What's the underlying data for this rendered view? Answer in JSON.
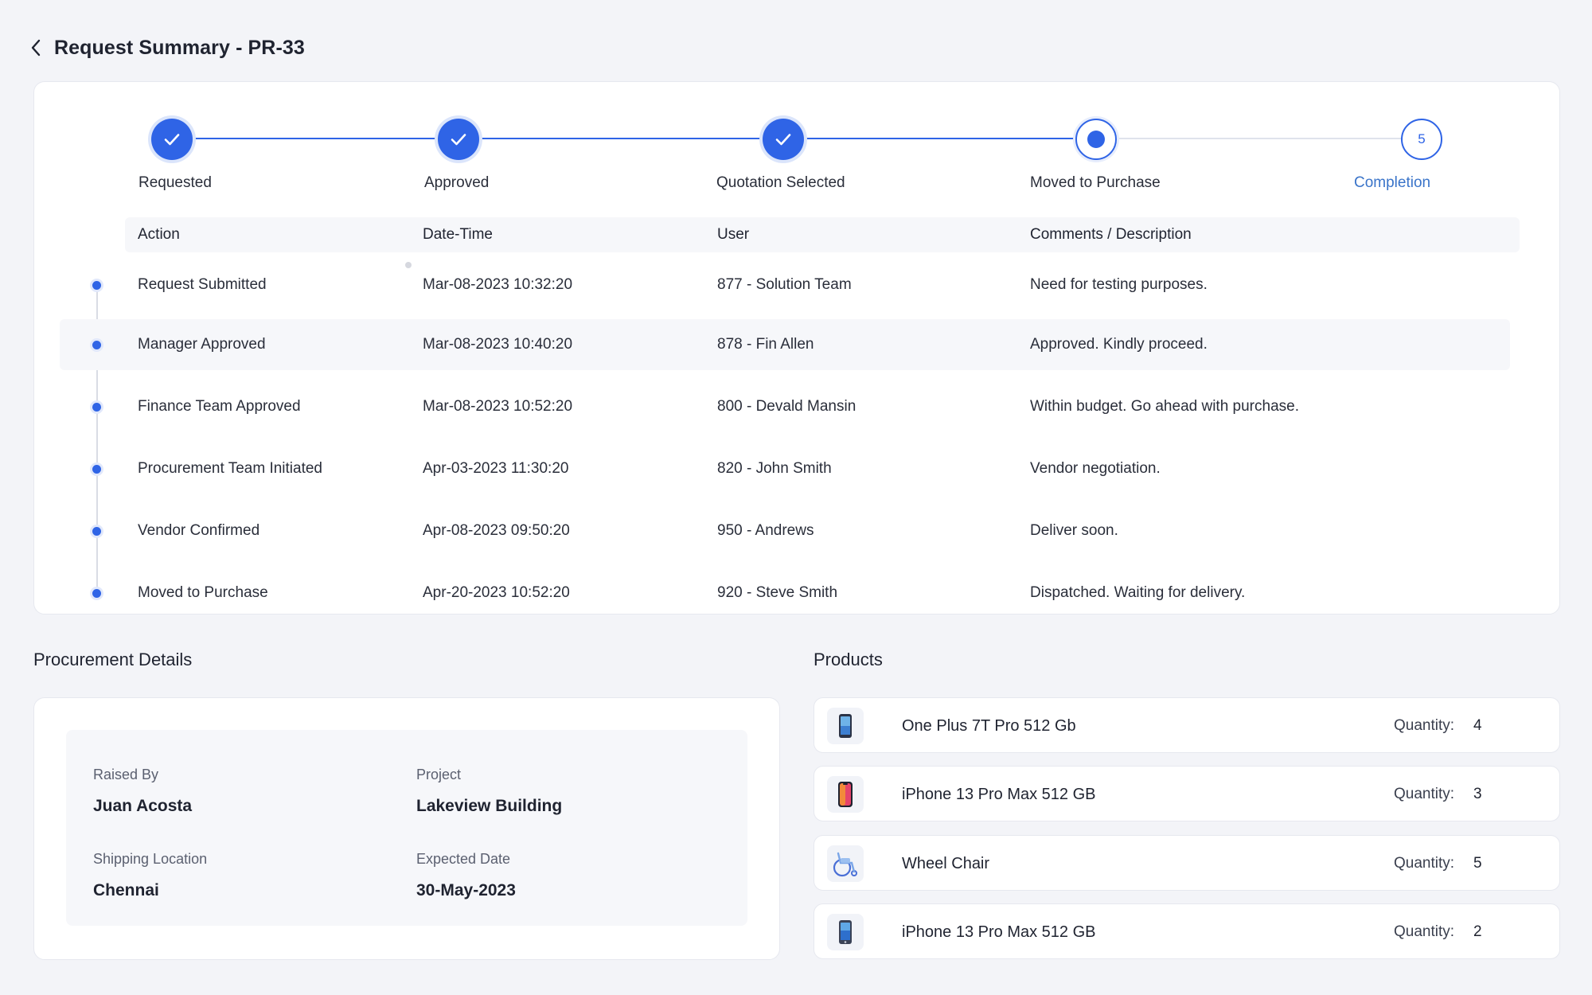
{
  "header": {
    "title": "Request Summary - PR-33"
  },
  "stepper": {
    "steps": [
      {
        "label": "Requested",
        "state": "done"
      },
      {
        "label": "Approved",
        "state": "done"
      },
      {
        "label": "Quotation Selected",
        "state": "done"
      },
      {
        "label": "Moved to Purchase",
        "state": "current"
      },
      {
        "label": "Completion",
        "state": "future",
        "number": "5"
      }
    ]
  },
  "history": {
    "columns": [
      "Action",
      "Date-Time",
      "User",
      "Comments / Description"
    ],
    "rows": [
      {
        "action": "Request Submitted",
        "datetime": "Mar-08-2023 10:32:20",
        "user": "877 - Solution Team",
        "comment": "Need for testing purposes."
      },
      {
        "action": "Manager Approved",
        "datetime": "Mar-08-2023 10:40:20",
        "user": "878 - Fin Allen",
        "comment": "Approved. Kindly proceed."
      },
      {
        "action": "Finance Team Approved",
        "datetime": "Mar-08-2023 10:52:20",
        "user": "800 - Devald Mansin",
        "comment": "Within budget. Go ahead with purchase."
      },
      {
        "action": "Procurement Team Initiated",
        "datetime": "Apr-03-2023 11:30:20",
        "user": "820 - John Smith",
        "comment": "Vendor negotiation."
      },
      {
        "action": "Vendor Confirmed",
        "datetime": "Apr-08-2023 09:50:20",
        "user": "950 - Andrews",
        "comment": "Deliver soon."
      },
      {
        "action": "Moved to Purchase",
        "datetime": "Apr-20-2023 10:52:20",
        "user": "920 - Steve Smith",
        "comment": "Dispatched. Waiting for delivery."
      }
    ]
  },
  "procurement": {
    "title": "Procurement Details",
    "raised_by_label": "Raised By",
    "raised_by": "Juan Acosta",
    "project_label": "Project",
    "project": "Lakeview Building",
    "shipping_label": "Shipping Location",
    "shipping": "Chennai",
    "expected_label": "Expected Date",
    "expected": "30-May-2023"
  },
  "products": {
    "title": "Products",
    "quantity_label": "Quantity:",
    "items": [
      {
        "name": "One Plus 7T Pro 512 Gb",
        "quantity": "4",
        "icon": "phone-icon"
      },
      {
        "name": "iPhone 13 Pro Max 512 GB",
        "quantity": "3",
        "icon": "phone-icon"
      },
      {
        "name": "Wheel Chair",
        "quantity": "5",
        "icon": "wheelchair-icon"
      },
      {
        "name": "iPhone 13 Pro Max 512 GB",
        "quantity": "2",
        "icon": "phone-icon"
      }
    ]
  },
  "colors": {
    "accent": "#2f64e6",
    "completion_text": "#3a74c9",
    "background": "#f3f4f8"
  }
}
